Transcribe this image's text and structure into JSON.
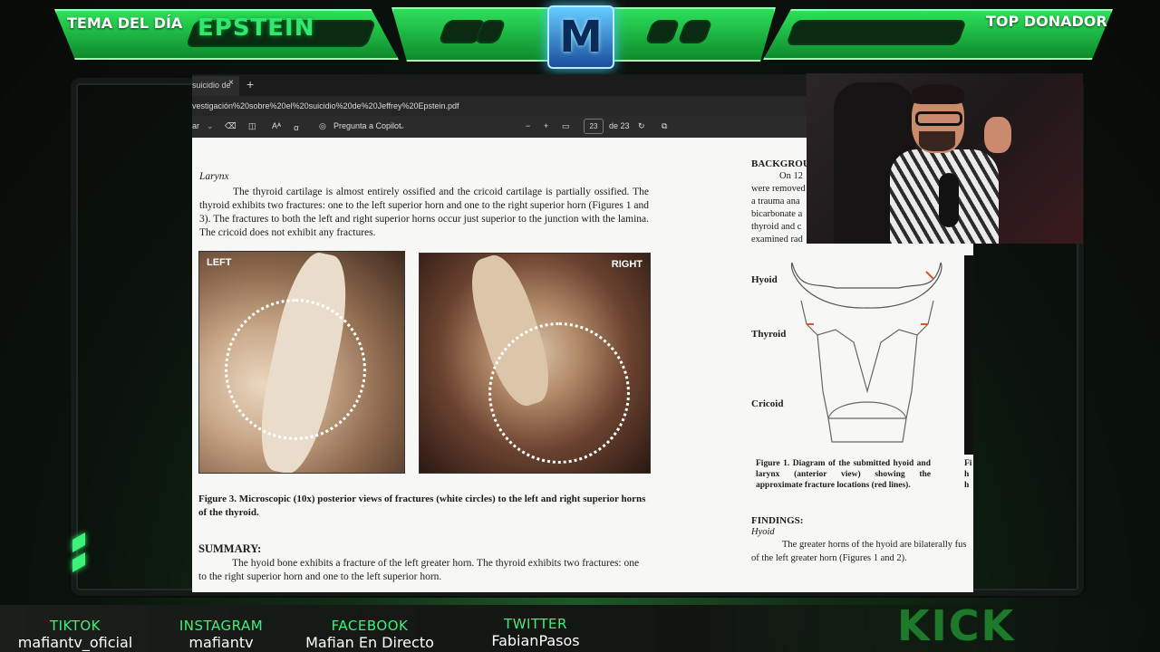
{
  "overlay": {
    "left_tab_label": "TEMA DEL DÍA",
    "topic": "EPSTEIN",
    "right_tab_label": "TOP DONADOR",
    "logo_letter": "M",
    "accent_color": "#2fe05a"
  },
  "browser": {
    "tab_title": "suicidio de",
    "tab_close": "×",
    "new_tab": "+",
    "url": "vestigación%20sobre%20el%20suicidio%20de%20Jeffrey%20Epstein.pdf"
  },
  "pdf_toolbar": {
    "left_label": "ar",
    "copilot": "Pregunta a Copilot",
    "zoom_out": "−",
    "zoom_in": "+",
    "page_current": "23",
    "page_total": "de 23"
  },
  "document": {
    "larynx_heading": "Larynx",
    "larynx_text": "The thyroid cartilage is almost entirely ossified and the cricoid cartilage is partially ossified. The thyroid exhibits two fractures: one to the left superior horn and one to the right superior horn (Figures 1 and 3). The fractures to both the left and right superior horns occur just superior to the junction with the lamina. The cricoid does not exhibit any fractures.",
    "photo_left_label": "LEFT",
    "photo_right_label": "RIGHT",
    "figure3_caption": "Figure 3. Microscopic (10x) posterior views of fractures (white circles) to the left and right superior horns of the thyroid.",
    "summary_heading": "SUMMARY:",
    "summary_text": "The hyoid bone exhibits a fracture of the left greater horn. The thyroid exhibits two fractures: one to the right superior horn and one to the left superior horn.",
    "background_heading": "BACKGROU",
    "background_lines": [
      "On 12",
      "were removed",
      "a trauma ana",
      "bicarbonate a",
      "thyroid and c",
      "examined rad"
    ],
    "diagram_labels": [
      "Hyoid",
      "Thyroid",
      "Cricoid"
    ],
    "figure1_caption": "Figure 1. Diagram of the submitted hyoid and larynx (anterior view) showing the approximate fracture locations (red lines).",
    "findings_heading": "FINDINGS:",
    "findings_sub": "Hyoid",
    "findings_text": "The greater horns of the hyoid are bilaterally fus of the left greater horn (Figures 1 and 2).",
    "right_edge_fragments": [
      "Fi",
      "h",
      "h"
    ]
  },
  "footer": {
    "socials": [
      {
        "network": "TIKTOK",
        "handle": "mafiantv_oficial"
      },
      {
        "network": "INSTAGRAM",
        "handle": "mafiantv"
      },
      {
        "network": "FACEBOOK",
        "handle": "Mafian En Directo"
      },
      {
        "network": "TWITTER",
        "handle": "FabianPasos"
      }
    ],
    "platform": "KICK"
  }
}
